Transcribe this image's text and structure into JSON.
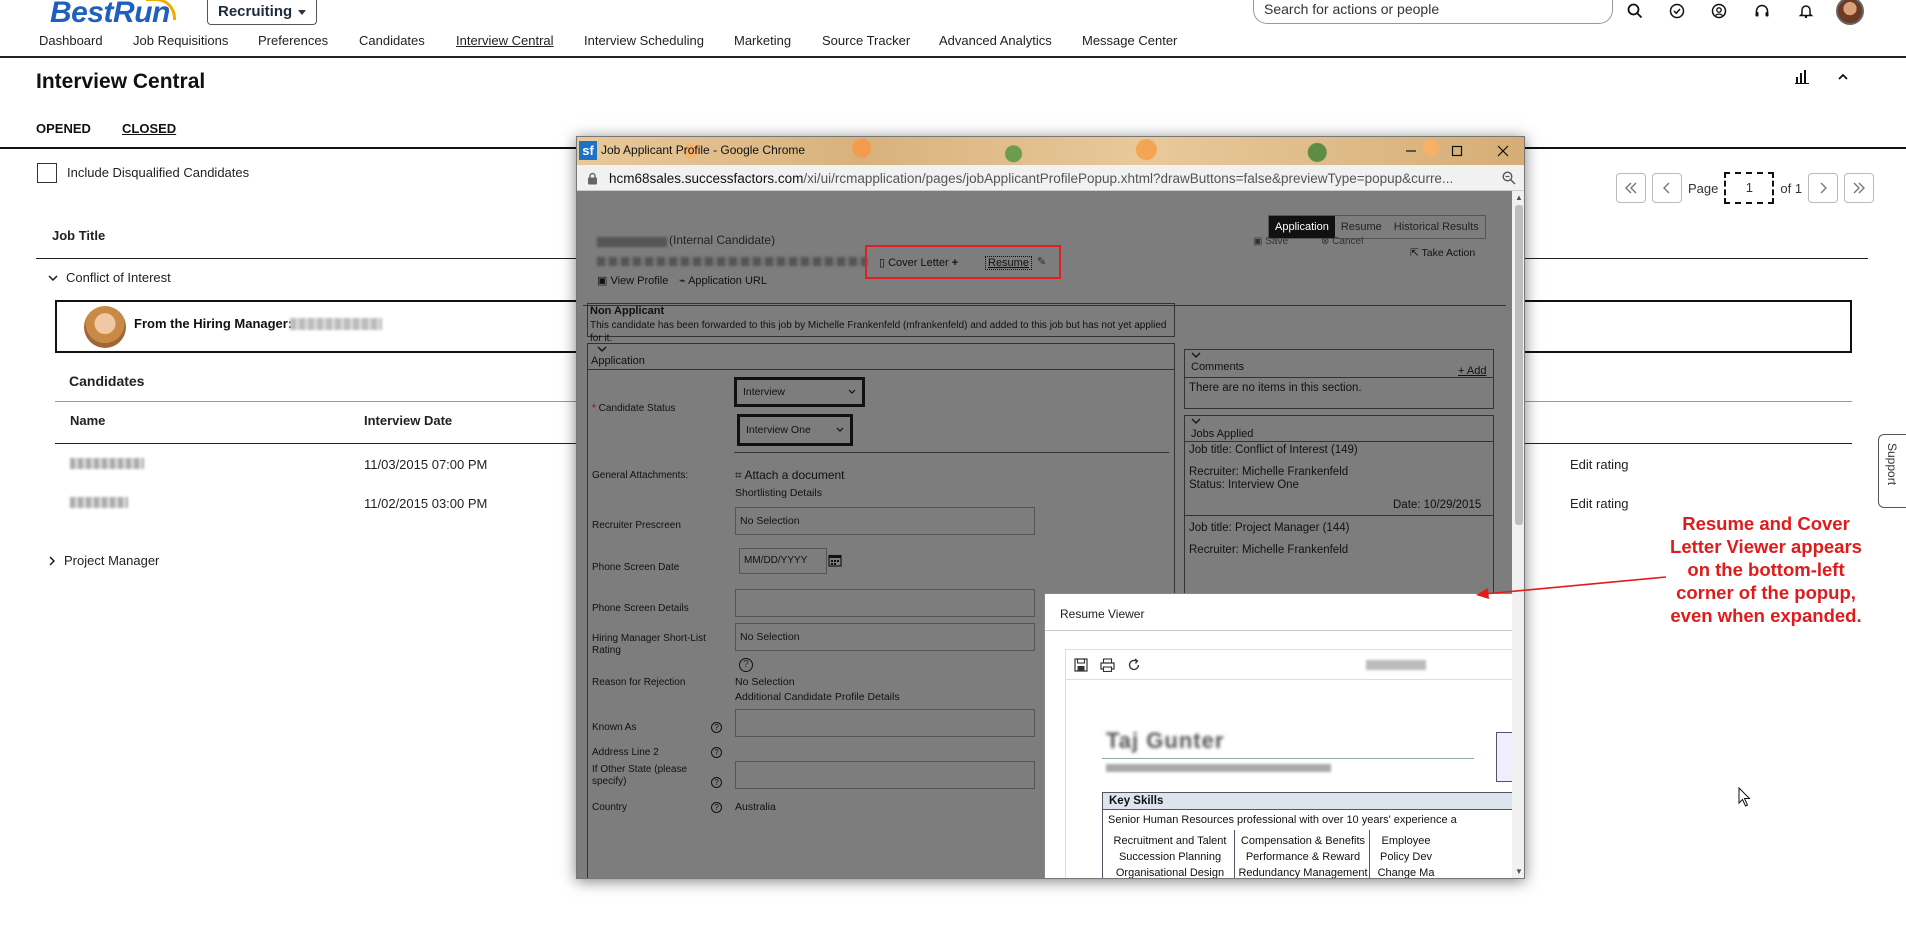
{
  "header": {
    "logo": "BestRun",
    "module": "Recruiting",
    "search_placeholder": "Search for actions or people",
    "nav": [
      "Dashboard",
      "Job Requisitions",
      "Preferences",
      "Candidates",
      "Interview Central",
      "Interview Scheduling",
      "Marketing",
      "Source Tracker",
      "Advanced Analytics",
      "Message Center"
    ],
    "active_nav": "Interview Central"
  },
  "page": {
    "title": "Interview Central",
    "tabs": [
      "OPENED",
      "CLOSED"
    ],
    "include_disqualified": "Include Disqualified Candidates",
    "pager": {
      "page_label": "Page",
      "page": "1",
      "of": "of 1"
    },
    "col_job_title": "Job Title",
    "group1": "Conflict of Interest",
    "hiring_manager_label": "From the Hiring Manager:",
    "candidates_heading": "Candidates",
    "col_name": "Name",
    "col_interview_date": "Interview Date",
    "candidates": [
      {
        "date": "11/03/2015 07:00 PM",
        "action": "Edit rating"
      },
      {
        "date": "11/02/2015 03:00 PM",
        "action": "Edit rating"
      }
    ],
    "group2": "Project Manager",
    "support": "Support"
  },
  "popup": {
    "window_title": "Job Applicant Profile - Google Chrome",
    "url_host": "hcm68sales.successfactors.com",
    "url_path": "/xi/ui/rcmapplication/pages/jobApplicantProfilePopup.xhtml?drawButtons=false&previewType=popup&curre...",
    "tabs": [
      "Application",
      "Resume",
      "Historical Results"
    ],
    "internal_candidate": "(Internal Candidate)",
    "cover_letter": "Cover Letter",
    "resume": "Resume",
    "view_profile": "View Profile",
    "application_url": "Application URL",
    "save": "Save",
    "cancel": "Cancel",
    "take_action": "Take Action",
    "non_applicant_title": "Non Applicant",
    "non_applicant_text": "This candidate has been forwarded to this job by Michelle Frankenfeld (mfrankenfeld) and added to this job but has not yet applied for it.",
    "application_title": "Application",
    "fields": {
      "candidate_status": "Candidate Status",
      "status_select_1": "Interview",
      "status_select_2": "Interview One",
      "general_attachments": "General Attachments:",
      "attach_document": "Attach a document",
      "shortlisting_details": "Shortlisting Details",
      "recruiter_prescreen": "Recruiter Prescreen",
      "recruiter_prescreen_value": "No Selection",
      "phone_screen_date": "Phone Screen Date",
      "phone_screen_date_placeholder": "MM/DD/YYYY",
      "phone_screen_details": "Phone Screen Details",
      "hm_shortlist": "Hiring Manager Short-List Rating",
      "hm_shortlist_value": "No Selection",
      "reason_rejection": "Reason for Rejection",
      "reason_rejection_value": "No Selection",
      "additional_details": "Additional Candidate Profile Details",
      "known_as": "Known As",
      "address_line_2": "Address Line 2",
      "if_other_state": "If Other State (please specify)",
      "country": "Country",
      "country_value": "Australia"
    },
    "comments_title": "Comments",
    "add": "+ Add",
    "no_items": "There are no items in this section.",
    "jobs_applied_title": "Jobs Applied",
    "jobs": [
      {
        "title": "Job title: Conflict of Interest (149)",
        "recruiter": "Recruiter: Michelle Frankenfeld",
        "status": "Status: Interview One",
        "date": "Date: 10/29/2015"
      },
      {
        "title": "Job title: Project Manager (144)",
        "recruiter": "Recruiter: Michelle Frankenfeld"
      }
    ]
  },
  "resume_viewer": {
    "title": "Resume Viewer",
    "resume_name": "Taj Gunter",
    "key_skills": "Key Skills",
    "summary": "Senior Human Resources professional with over 10 years' experience a",
    "skills_col1": [
      "Recruitment and Talent",
      "Succession Planning",
      "Organisational Design"
    ],
    "skills_col2": [
      "Compensation & Benefits",
      "Performance & Reward",
      "Redundancy Management"
    ],
    "skills_col3": [
      "Employee",
      "Policy Dev",
      "Change Ma"
    ]
  },
  "annotation": "Resume and Cover Letter Viewer appears on the bottom-left corner of the popup, even when expanded.",
  "colors": {
    "annotation": "#e01b1b",
    "brand": "#1f5fbd",
    "accent": "#f0ab00"
  }
}
